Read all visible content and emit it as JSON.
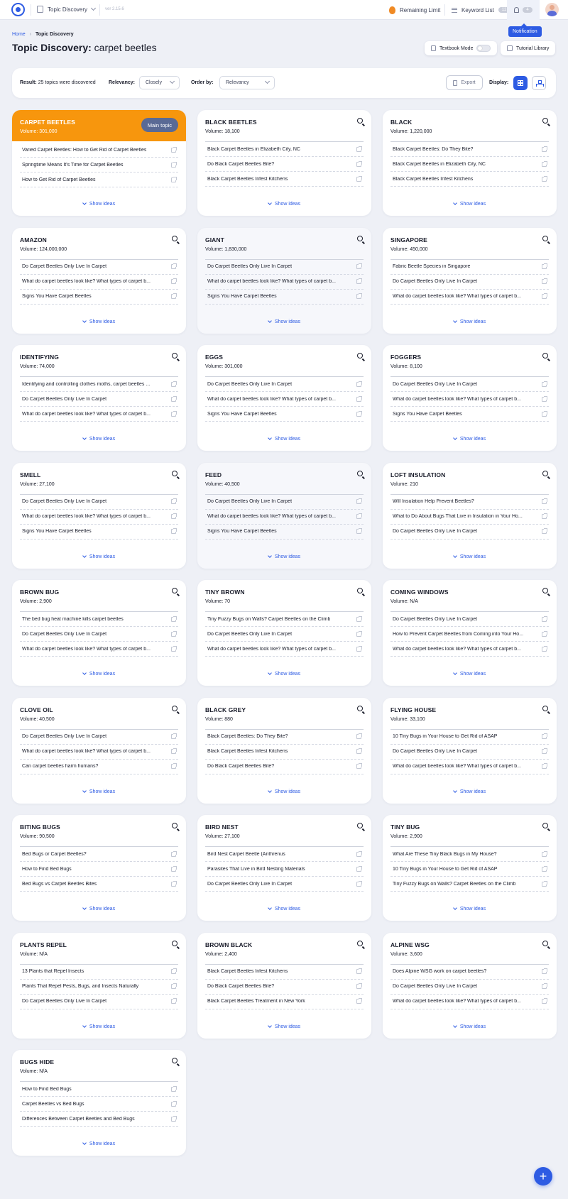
{
  "topbar": {
    "app_name": "Topic Discovery",
    "version": "ver 2.15.6",
    "remaining_limit": "Remaining Limit",
    "keyword_list": "Keyword List",
    "keyword_count": "11",
    "notification_count": "4",
    "notification_tooltip": "Notification"
  },
  "breadcrumb": {
    "home": "Home",
    "current": "Topic Discovery"
  },
  "page": {
    "title_prefix": "Topic Discovery:",
    "keyword": "carpet beetles"
  },
  "header_buttons": {
    "textbook_mode": "Textbook Mode",
    "tutorial_library": "Tutorial Library"
  },
  "filter": {
    "result_label": "Result:",
    "result_text": "25 topics were discovered",
    "relevancy_label": "Relevancy:",
    "relevancy_value": "Closely",
    "order_label": "Order by:",
    "order_value": "Relevancy",
    "export_label": "Export",
    "display_label": "Display:"
  },
  "main_topic_label": "Main topic",
  "show_ideas_label": "Show ideas",
  "volume_label": "Volume:",
  "cards": [
    {
      "title": "CARPET BEETLES",
      "volume": "301,000",
      "main": true,
      "ideas": [
        "Varied Carpet Beetles: How to Get Rid of Carpet Beetles",
        "Springtime Means It's Time for Carpet Beetles",
        "How to Get Rid of Carpet Beetles"
      ]
    },
    {
      "title": "BLACK BEETLES",
      "volume": "18,100",
      "ideas": [
        "Black Carpet Beetles in Elizabeth City, NC",
        "Do Black Carpet Beetles Bite?",
        "Black Carpet Beetles Infest Kitchens"
      ]
    },
    {
      "title": "BLACK",
      "volume": "1,220,000",
      "ideas": [
        "Black Carpet Beetles: Do They Bite?",
        "Black Carpet Beetles in Elizabeth City, NC",
        "Black Carpet Beetles Infest Kitchens"
      ]
    },
    {
      "title": "AMAZON",
      "volume": "124,000,000",
      "ideas": [
        "Do Carpet Beetles Only Live In Carpet",
        "What do carpet beetles look like? What types of carpet b...",
        "Signs You Have Carpet Beetles"
      ]
    },
    {
      "title": "GIANT",
      "volume": "1,830,000",
      "dim": true,
      "ideas": [
        "Do Carpet Beetles Only Live In Carpet",
        "What do carpet beetles look like? What types of carpet b...",
        "Signs You Have Carpet Beetles"
      ]
    },
    {
      "title": "SINGAPORE",
      "volume": "450,000",
      "ideas": [
        "Fabric Beetle Species in Singapore",
        "Do Carpet Beetles Only Live In Carpet",
        "What do carpet beetles look like? What types of carpet b..."
      ]
    },
    {
      "title": "IDENTIFYING",
      "volume": "74,000",
      "ideas": [
        "Identifying and controlling clothes moths, carpet beetles ...",
        "Do Carpet Beetles Only Live In Carpet",
        "What do carpet beetles look like? What types of carpet b..."
      ]
    },
    {
      "title": "EGGS",
      "volume": "301,000",
      "ideas": [
        "Do Carpet Beetles Only Live In Carpet",
        "What do carpet beetles look like? What types of carpet b...",
        "Signs You Have Carpet Beetles"
      ]
    },
    {
      "title": "FOGGERS",
      "volume": "8,100",
      "ideas": [
        "Do Carpet Beetles Only Live In Carpet",
        "What do carpet beetles look like? What types of carpet b...",
        "Signs You Have Carpet Beetles"
      ]
    },
    {
      "title": "SMELL",
      "volume": "27,100",
      "ideas": [
        "Do Carpet Beetles Only Live In Carpet",
        "What do carpet beetles look like? What types of carpet b...",
        "Signs You Have Carpet Beetles"
      ]
    },
    {
      "title": "FEED",
      "volume": "40,500",
      "dim": true,
      "ideas": [
        "Do Carpet Beetles Only Live In Carpet",
        "What do carpet beetles look like? What types of carpet b...",
        "Signs You Have Carpet Beetles"
      ]
    },
    {
      "title": "LOFT INSULATION",
      "volume": "210",
      "ideas": [
        "Will Insulation Help Prevent Beetles?",
        "What to Do About Bugs That Live in Insulation in Your Ho...",
        "Do Carpet Beetles Only Live In Carpet"
      ]
    },
    {
      "title": "BROWN BUG",
      "volume": "2,900",
      "ideas": [
        "The bed bug heat machine kills carpet beetles",
        "Do Carpet Beetles Only Live In Carpet",
        "What do carpet beetles look like? What types of carpet b..."
      ]
    },
    {
      "title": "TINY BROWN",
      "volume": "70",
      "ideas": [
        "Tiny Fuzzy Bugs on Walls? Carpet Beetles on the Climb",
        "Do Carpet Beetles Only Live In Carpet",
        "What do carpet beetles look like? What types of carpet b..."
      ]
    },
    {
      "title": "COMING WINDOWS",
      "volume": "N/A",
      "ideas": [
        "Do Carpet Beetles Only Live In Carpet",
        "How to Prevent Carpet Beetles from Coming into Your Ho...",
        "What do carpet beetles look like? What types of carpet b..."
      ]
    },
    {
      "title": "CLOVE OIL",
      "volume": "40,500",
      "ideas": [
        "Do Carpet Beetles Only Live In Carpet",
        "What do carpet beetles look like? What types of carpet b...",
        "Can carpet beetles harm humans?"
      ]
    },
    {
      "title": "BLACK GREY",
      "volume": "880",
      "ideas": [
        "Black Carpet Beetles: Do They Bite?",
        "Black Carpet Beetles Infest Kitchens",
        "Do Black Carpet Beetles Bite?"
      ]
    },
    {
      "title": "FLYING HOUSE",
      "volume": "33,100",
      "ideas": [
        "10 Tiny Bugs in Your House to Get Rid of ASAP",
        "Do Carpet Beetles Only Live In Carpet",
        "What do carpet beetles look like? What types of carpet b..."
      ]
    },
    {
      "title": "BITING BUGS",
      "volume": "90,500",
      "ideas": [
        "Bed Bugs or Carpet Beetles?",
        "How to Find Bed Bugs",
        "Bed Bugs vs Carpet Beetles Bites"
      ]
    },
    {
      "title": "BIRD NEST",
      "volume": "27,100",
      "ideas": [
        "Bird Nest Carpet Beetle (Anthrenus",
        "Parasites That Live in Bird Nesting Materials",
        "Do Carpet Beetles Only Live In Carpet"
      ]
    },
    {
      "title": "TINY BUG",
      "volume": "2,900",
      "ideas": [
        "What Are These Tiny Black Bugs in My House?",
        "10 Tiny Bugs in Your House to Get Rid of ASAP",
        "Tiny Fuzzy Bugs on Walls? Carpet Beetles on the Climb"
      ]
    },
    {
      "title": "PLANTS REPEL",
      "volume": "N/A",
      "ideas": [
        "13 Plants that Repel Insects",
        "Plants That Repel Pests, Bugs, and Insects Naturally",
        "Do Carpet Beetles Only Live In Carpet"
      ]
    },
    {
      "title": "BROWN BLACK",
      "volume": "2,400",
      "ideas": [
        "Black Carpet Beetles Infest Kitchens",
        "Do Black Carpet Beetles Bite?",
        "Black Carpet Beetles Treatment in New York"
      ]
    },
    {
      "title": "ALPINE WSG",
      "volume": "3,600",
      "ideas": [
        "Does Alpine WSG work on carpet beetles?",
        "Do Carpet Beetles Only Live In Carpet",
        "What do carpet beetles look like? What types of carpet b..."
      ]
    },
    {
      "title": "BUGS HIDE",
      "volume": "N/A",
      "ideas": [
        "How to Find Bed Bugs",
        "Carpet Beetles vs Bed Bugs",
        "Differences Between Carpet Beetles and Bed Bugs"
      ]
    }
  ],
  "fab_label": "+"
}
